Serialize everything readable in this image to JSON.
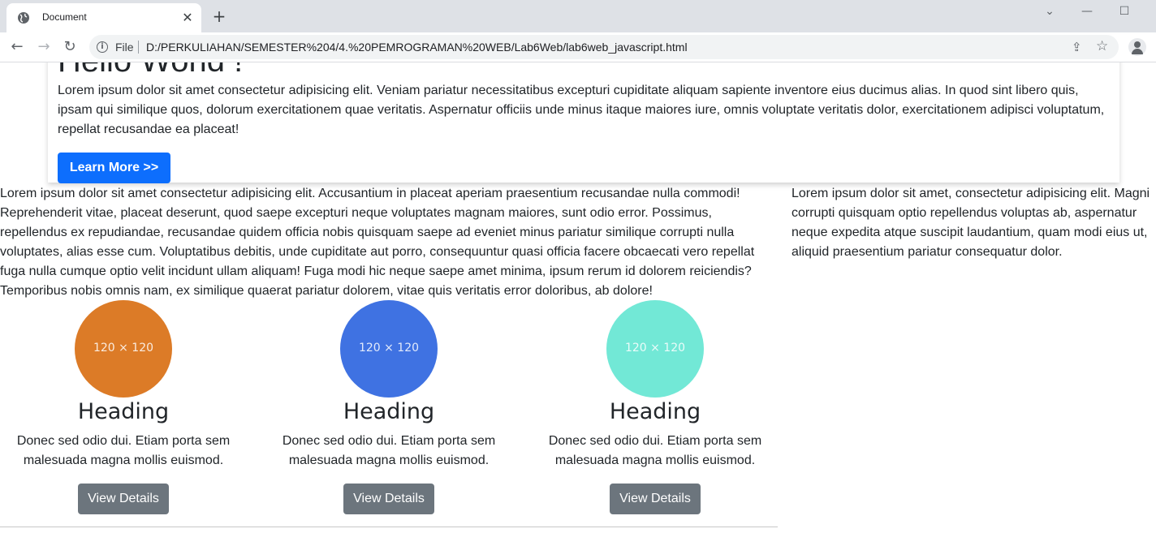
{
  "browser": {
    "tab_title": "Document",
    "tab_close": "✕",
    "new_tab": "+",
    "scheme_label": "File",
    "url": "D:/PERKULIAHAN/SEMESTER%204/4.%20PEMROGRAMAN%20WEB/Lab6Web/lab6web_javascript.html"
  },
  "jumbotron": {
    "heading": "Hello World !",
    "text": "Lorem ipsum dolor sit amet consectetur adipisicing elit. Veniam pariatur necessitatibus excepturi cupiditate aliquam sapiente inventore eius ducimus alias. In quod sint libero quis, ipsam qui similique quos, dolorum exercitationem quae veritatis. Aspernatur officiis unde minus itaque maiores iure, omnis voluptate veritatis dolor, exercitationem adipisci voluptatum, repellat recusandae ea placeat!",
    "button_label": "Learn More >>"
  },
  "main_text": "Lorem ipsum dolor sit amet consectetur adipisicing elit. Accusantium in placeat aperiam praesentium recusandae nulla commodi! Reprehenderit vitae, placeat deserunt, quod saepe excepturi neque voluptates magnam maiores, sunt odio error. Possimus, repellendus ex repudiandae, recusandae quidem officia nobis quisquam saepe ad eveniet minus pariatur similique corrupti nulla voluptates, alias esse cum. Voluptatibus debitis, unde cupiditate aut porro, consequuntur quasi officia facere obcaecati vero repellat fuga nulla cumque optio velit incidunt ullam aliquam! Fuga modi hic neque saepe amet minima, ipsum rerum id dolorem reiciendis? Temporibus nobis omnis nam, ex similique quaerat pariatur dolorem, vitae quis veritatis error doloribus, ab dolore!",
  "sidebar_text": "Lorem ipsum dolor sit amet, consectetur adipisicing elit. Magni corrupti quisquam optio repellendus voluptas ab, aspernatur neque expedita atque suscipit laudantium, quam modi eius ut, aliquid praesentium pariatur consequatur dolor.",
  "features": [
    {
      "placeholder": "120 × 120",
      "color": "#dc7b27",
      "heading": "Heading",
      "text": "Donec sed odio dui. Etiam porta sem malesuada magna mollis euismod.",
      "button_label": "View Details"
    },
    {
      "placeholder": "120 × 120",
      "color": "#3f72e2",
      "heading": "Heading",
      "text": "Donec sed odio dui. Etiam porta sem malesuada magna mollis euismod.",
      "button_label": "View Details"
    },
    {
      "placeholder": "120 × 120",
      "color": "#72e8d6",
      "heading": "Heading",
      "text": "Donec sed odio dui. Etiam porta sem malesuada magna mollis euismod.",
      "button_label": "View Details"
    }
  ]
}
